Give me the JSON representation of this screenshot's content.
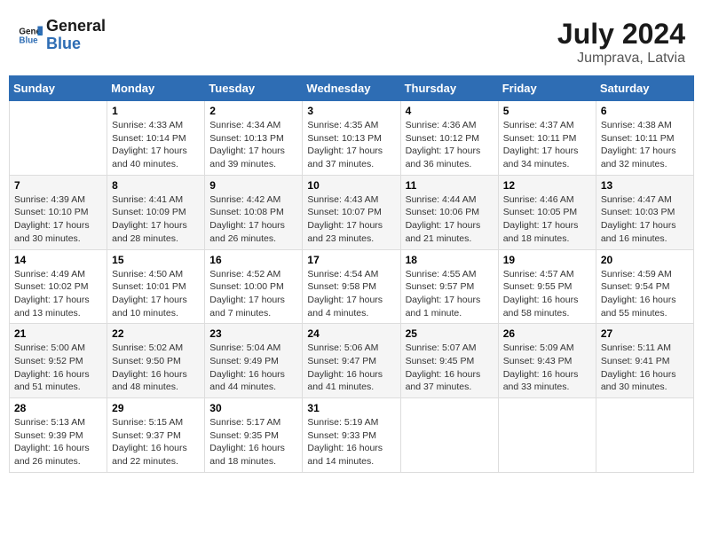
{
  "logo": {
    "line1": "General",
    "line2": "Blue"
  },
  "title": "July 2024",
  "location": "Jumprava, Latvia",
  "days_header": [
    "Sunday",
    "Monday",
    "Tuesday",
    "Wednesday",
    "Thursday",
    "Friday",
    "Saturday"
  ],
  "weeks": [
    [
      {
        "day": "",
        "info": ""
      },
      {
        "day": "1",
        "info": "Sunrise: 4:33 AM\nSunset: 10:14 PM\nDaylight: 17 hours\nand 40 minutes."
      },
      {
        "day": "2",
        "info": "Sunrise: 4:34 AM\nSunset: 10:13 PM\nDaylight: 17 hours\nand 39 minutes."
      },
      {
        "day": "3",
        "info": "Sunrise: 4:35 AM\nSunset: 10:13 PM\nDaylight: 17 hours\nand 37 minutes."
      },
      {
        "day": "4",
        "info": "Sunrise: 4:36 AM\nSunset: 10:12 PM\nDaylight: 17 hours\nand 36 minutes."
      },
      {
        "day": "5",
        "info": "Sunrise: 4:37 AM\nSunset: 10:11 PM\nDaylight: 17 hours\nand 34 minutes."
      },
      {
        "day": "6",
        "info": "Sunrise: 4:38 AM\nSunset: 10:11 PM\nDaylight: 17 hours\nand 32 minutes."
      }
    ],
    [
      {
        "day": "7",
        "info": "Sunrise: 4:39 AM\nSunset: 10:10 PM\nDaylight: 17 hours\nand 30 minutes."
      },
      {
        "day": "8",
        "info": "Sunrise: 4:41 AM\nSunset: 10:09 PM\nDaylight: 17 hours\nand 28 minutes."
      },
      {
        "day": "9",
        "info": "Sunrise: 4:42 AM\nSunset: 10:08 PM\nDaylight: 17 hours\nand 26 minutes."
      },
      {
        "day": "10",
        "info": "Sunrise: 4:43 AM\nSunset: 10:07 PM\nDaylight: 17 hours\nand 23 minutes."
      },
      {
        "day": "11",
        "info": "Sunrise: 4:44 AM\nSunset: 10:06 PM\nDaylight: 17 hours\nand 21 minutes."
      },
      {
        "day": "12",
        "info": "Sunrise: 4:46 AM\nSunset: 10:05 PM\nDaylight: 17 hours\nand 18 minutes."
      },
      {
        "day": "13",
        "info": "Sunrise: 4:47 AM\nSunset: 10:03 PM\nDaylight: 17 hours\nand 16 minutes."
      }
    ],
    [
      {
        "day": "14",
        "info": "Sunrise: 4:49 AM\nSunset: 10:02 PM\nDaylight: 17 hours\nand 13 minutes."
      },
      {
        "day": "15",
        "info": "Sunrise: 4:50 AM\nSunset: 10:01 PM\nDaylight: 17 hours\nand 10 minutes."
      },
      {
        "day": "16",
        "info": "Sunrise: 4:52 AM\nSunset: 10:00 PM\nDaylight: 17 hours\nand 7 minutes."
      },
      {
        "day": "17",
        "info": "Sunrise: 4:54 AM\nSunset: 9:58 PM\nDaylight: 17 hours\nand 4 minutes."
      },
      {
        "day": "18",
        "info": "Sunrise: 4:55 AM\nSunset: 9:57 PM\nDaylight: 17 hours\nand 1 minute."
      },
      {
        "day": "19",
        "info": "Sunrise: 4:57 AM\nSunset: 9:55 PM\nDaylight: 16 hours\nand 58 minutes."
      },
      {
        "day": "20",
        "info": "Sunrise: 4:59 AM\nSunset: 9:54 PM\nDaylight: 16 hours\nand 55 minutes."
      }
    ],
    [
      {
        "day": "21",
        "info": "Sunrise: 5:00 AM\nSunset: 9:52 PM\nDaylight: 16 hours\nand 51 minutes."
      },
      {
        "day": "22",
        "info": "Sunrise: 5:02 AM\nSunset: 9:50 PM\nDaylight: 16 hours\nand 48 minutes."
      },
      {
        "day": "23",
        "info": "Sunrise: 5:04 AM\nSunset: 9:49 PM\nDaylight: 16 hours\nand 44 minutes."
      },
      {
        "day": "24",
        "info": "Sunrise: 5:06 AM\nSunset: 9:47 PM\nDaylight: 16 hours\nand 41 minutes."
      },
      {
        "day": "25",
        "info": "Sunrise: 5:07 AM\nSunset: 9:45 PM\nDaylight: 16 hours\nand 37 minutes."
      },
      {
        "day": "26",
        "info": "Sunrise: 5:09 AM\nSunset: 9:43 PM\nDaylight: 16 hours\nand 33 minutes."
      },
      {
        "day": "27",
        "info": "Sunrise: 5:11 AM\nSunset: 9:41 PM\nDaylight: 16 hours\nand 30 minutes."
      }
    ],
    [
      {
        "day": "28",
        "info": "Sunrise: 5:13 AM\nSunset: 9:39 PM\nDaylight: 16 hours\nand 26 minutes."
      },
      {
        "day": "29",
        "info": "Sunrise: 5:15 AM\nSunset: 9:37 PM\nDaylight: 16 hours\nand 22 minutes."
      },
      {
        "day": "30",
        "info": "Sunrise: 5:17 AM\nSunset: 9:35 PM\nDaylight: 16 hours\nand 18 minutes."
      },
      {
        "day": "31",
        "info": "Sunrise: 5:19 AM\nSunset: 9:33 PM\nDaylight: 16 hours\nand 14 minutes."
      },
      {
        "day": "",
        "info": ""
      },
      {
        "day": "",
        "info": ""
      },
      {
        "day": "",
        "info": ""
      }
    ]
  ]
}
